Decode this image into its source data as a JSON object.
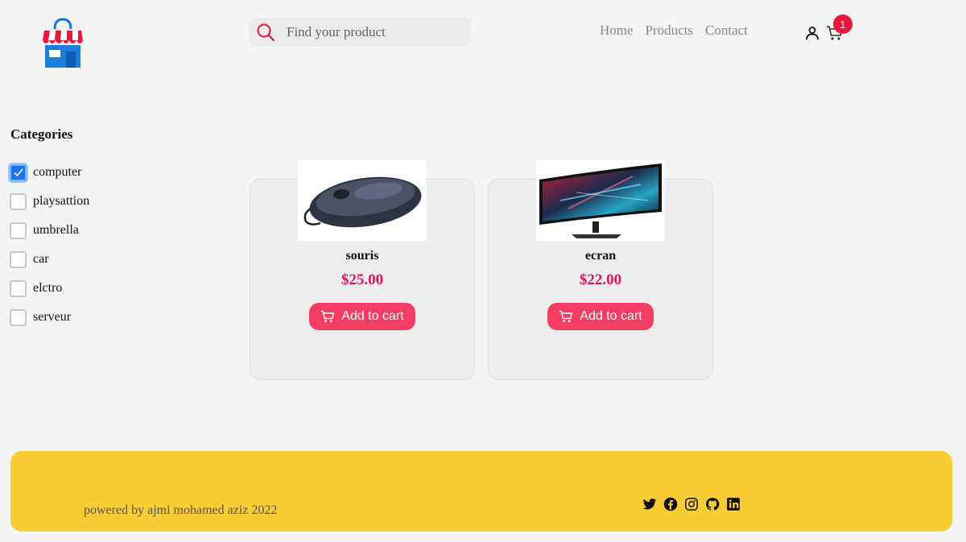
{
  "header": {
    "search": {
      "placeholder": "Find your product",
      "value": ""
    },
    "nav": [
      {
        "label": "Home"
      },
      {
        "label": "Products"
      },
      {
        "label": "Contact"
      }
    ],
    "cart_count": "1"
  },
  "sidebar": {
    "title": "Categories",
    "categories": [
      {
        "label": "computer",
        "checked": true
      },
      {
        "label": "playsattion",
        "checked": false
      },
      {
        "label": "umbrella",
        "checked": false
      },
      {
        "label": "car",
        "checked": false
      },
      {
        "label": "elctro",
        "checked": false
      },
      {
        "label": "serveur",
        "checked": false
      }
    ]
  },
  "products": [
    {
      "name": "souris",
      "price": "$25.00",
      "button": "Add to cart"
    },
    {
      "name": "ecran",
      "price": "$22.00",
      "button": "Add to cart"
    }
  ],
  "footer": {
    "credit": "powered by ajmi mohamed aziz 2022",
    "socials": [
      "twitter-icon",
      "facebook-icon",
      "instagram-icon",
      "github-icon",
      "linkedin-icon"
    ]
  },
  "colors": {
    "accent": "#f53d64",
    "price": "#e0125a",
    "badge": "#e8173b",
    "footer": "#f8cc32",
    "checkbox": "#1a73e8"
  }
}
